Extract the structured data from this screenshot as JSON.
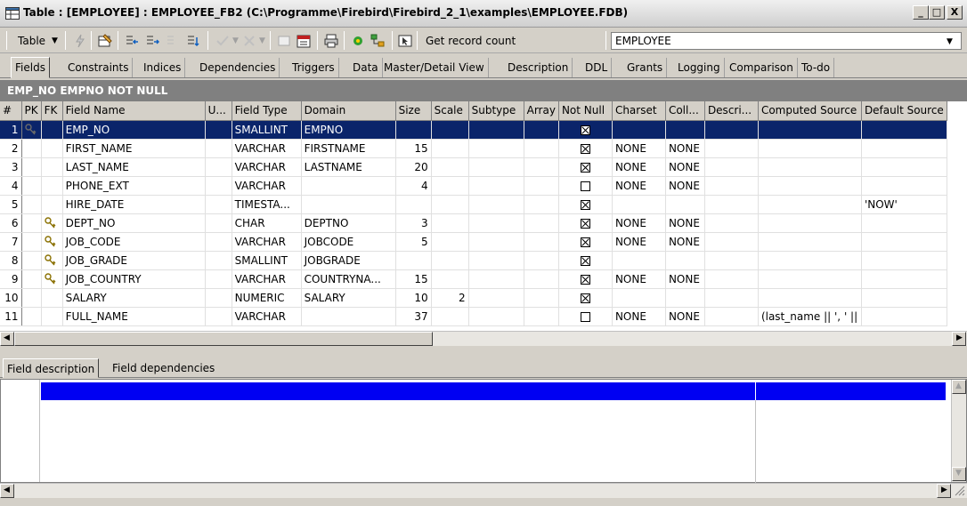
{
  "window": {
    "title": "Table : [EMPLOYEE] : EMPLOYEE_FB2 (C:\\Programme\\Firebird\\Firebird_2_1\\examples\\EMPLOYEE.FDB)",
    "min": "_",
    "max": "□",
    "close": "X"
  },
  "toolbar": {
    "table_menu": "Table",
    "get_record_count": "Get record count",
    "table_selector_value": "EMPLOYEE"
  },
  "tabs": [
    "Fields",
    "Constraints",
    "Indices",
    "Dependencies",
    "Triggers",
    "Data",
    "Master/Detail View",
    "Description",
    "DDL",
    "Grants",
    "Logging",
    "Comparison",
    "To-do"
  ],
  "header_band": "EMP_NO EMPNO NOT NULL",
  "grid": {
    "columns": [
      "#",
      "PK",
      "FK",
      "Field Name",
      "U...",
      "Field Type",
      "Domain",
      "Size",
      "Scale",
      "Subtype",
      "Array",
      "Not Null",
      "Charset",
      "Coll...",
      "Descri...",
      "Computed Source",
      "Default Source"
    ],
    "rows": [
      {
        "n": "1",
        "pk": true,
        "fk": false,
        "name": "EMP_NO",
        "type": "SMALLINT",
        "domain": "EMPNO",
        "size": "",
        "scale": "",
        "notnull": true,
        "charset": "",
        "coll": "",
        "computed": "",
        "default": ""
      },
      {
        "n": "2",
        "pk": false,
        "fk": false,
        "name": "FIRST_NAME",
        "type": "VARCHAR",
        "domain": "FIRSTNAME",
        "size": "15",
        "scale": "",
        "notnull": true,
        "charset": "NONE",
        "coll": "NONE",
        "computed": "",
        "default": ""
      },
      {
        "n": "3",
        "pk": false,
        "fk": false,
        "name": "LAST_NAME",
        "type": "VARCHAR",
        "domain": "LASTNAME",
        "size": "20",
        "scale": "",
        "notnull": true,
        "charset": "NONE",
        "coll": "NONE",
        "computed": "",
        "default": ""
      },
      {
        "n": "4",
        "pk": false,
        "fk": false,
        "name": "PHONE_EXT",
        "type": "VARCHAR",
        "domain": "",
        "size": "4",
        "scale": "",
        "notnull": false,
        "charset": "NONE",
        "coll": "NONE",
        "computed": "",
        "default": ""
      },
      {
        "n": "5",
        "pk": false,
        "fk": false,
        "name": "HIRE_DATE",
        "type": "TIMESTA...",
        "domain": "",
        "size": "",
        "scale": "",
        "notnull": true,
        "charset": "",
        "coll": "",
        "computed": "",
        "default": "'NOW'"
      },
      {
        "n": "6",
        "pk": false,
        "fk": true,
        "name": "DEPT_NO",
        "type": "CHAR",
        "domain": "DEPTNO",
        "size": "3",
        "scale": "",
        "notnull": true,
        "charset": "NONE",
        "coll": "NONE",
        "computed": "",
        "default": ""
      },
      {
        "n": "7",
        "pk": false,
        "fk": true,
        "name": "JOB_CODE",
        "type": "VARCHAR",
        "domain": "JOBCODE",
        "size": "5",
        "scale": "",
        "notnull": true,
        "charset": "NONE",
        "coll": "NONE",
        "computed": "",
        "default": ""
      },
      {
        "n": "8",
        "pk": false,
        "fk": true,
        "name": "JOB_GRADE",
        "type": "SMALLINT",
        "domain": "JOBGRADE",
        "size": "",
        "scale": "",
        "notnull": true,
        "charset": "",
        "coll": "",
        "computed": "",
        "default": ""
      },
      {
        "n": "9",
        "pk": false,
        "fk": true,
        "name": "JOB_COUNTRY",
        "type": "VARCHAR",
        "domain": "COUNTRYNA...",
        "size": "15",
        "scale": "",
        "notnull": true,
        "charset": "NONE",
        "coll": "NONE",
        "computed": "",
        "default": ""
      },
      {
        "n": "10",
        "pk": false,
        "fk": false,
        "name": "SALARY",
        "type": "NUMERIC",
        "domain": "SALARY",
        "size": "10",
        "scale": "2",
        "notnull": true,
        "charset": "",
        "coll": "",
        "computed": "",
        "default": ""
      },
      {
        "n": "11",
        "pk": false,
        "fk": false,
        "name": "FULL_NAME",
        "type": "VARCHAR",
        "domain": "",
        "size": "37",
        "scale": "",
        "notnull": false,
        "charset": "NONE",
        "coll": "NONE",
        "computed": "(last_name || ', ' ||",
        "default": ""
      }
    ]
  },
  "lower_tabs": [
    "Field description",
    "Field dependencies"
  ],
  "colors": {
    "selection": "#0a246a",
    "desc_bar": "#0000f2",
    "band": "#808080"
  },
  "icons": [
    "table-icon",
    "key-icon",
    "foreign-key-icon"
  ]
}
